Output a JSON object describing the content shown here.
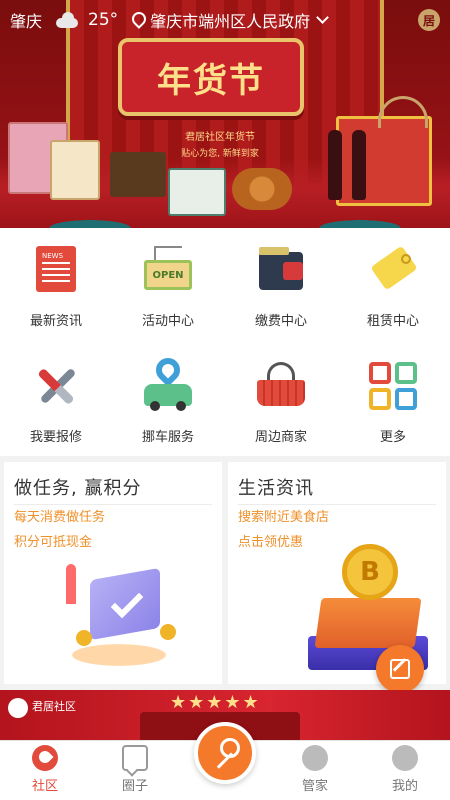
{
  "topbar": {
    "city": "肇庆",
    "weather_icon": "cloud-icon",
    "temperature": "25°",
    "address": "肇庆市端州区人民政府",
    "badge": "居"
  },
  "banner": {
    "title": "年货节",
    "subtitle": "君居社区年货节",
    "tagline": "贴心为您, 新鲜到家"
  },
  "grid": {
    "items": [
      {
        "label": "最新资讯",
        "icon": "news-icon"
      },
      {
        "label": "活动中心",
        "icon": "open-sign-icon",
        "icon_text": "OPEN"
      },
      {
        "label": "缴费中心",
        "icon": "wallet-icon"
      },
      {
        "label": "租赁中心",
        "icon": "tag-icon"
      },
      {
        "label": "我要报修",
        "icon": "tools-icon"
      },
      {
        "label": "挪车服务",
        "icon": "car-location-icon"
      },
      {
        "label": "周边商家",
        "icon": "shopping-basket-icon"
      },
      {
        "label": "更多",
        "icon": "more-grid-icon"
      }
    ]
  },
  "cards": {
    "tasks": {
      "title": "做任务, 赢积分",
      "line1": "每天消费做任务",
      "line2": "积分可抵现金"
    },
    "life": {
      "title": "生活资讯",
      "line1": "搜索附近美食店",
      "line2": "点击领优惠"
    }
  },
  "promo": {
    "brand": "君居社区",
    "stars": "★★★★★"
  },
  "tabbar": {
    "tabs": [
      {
        "label": "社区",
        "active": true
      },
      {
        "label": "圈子",
        "active": false
      },
      {
        "label": "",
        "active": false
      },
      {
        "label": "管家",
        "active": false
      },
      {
        "label": "我的",
        "active": false
      }
    ]
  },
  "colors": {
    "accent": "#f5792a",
    "active_tab": "#e24a3b",
    "card_text": "#f0902a",
    "banner_red": "#9b1313"
  }
}
